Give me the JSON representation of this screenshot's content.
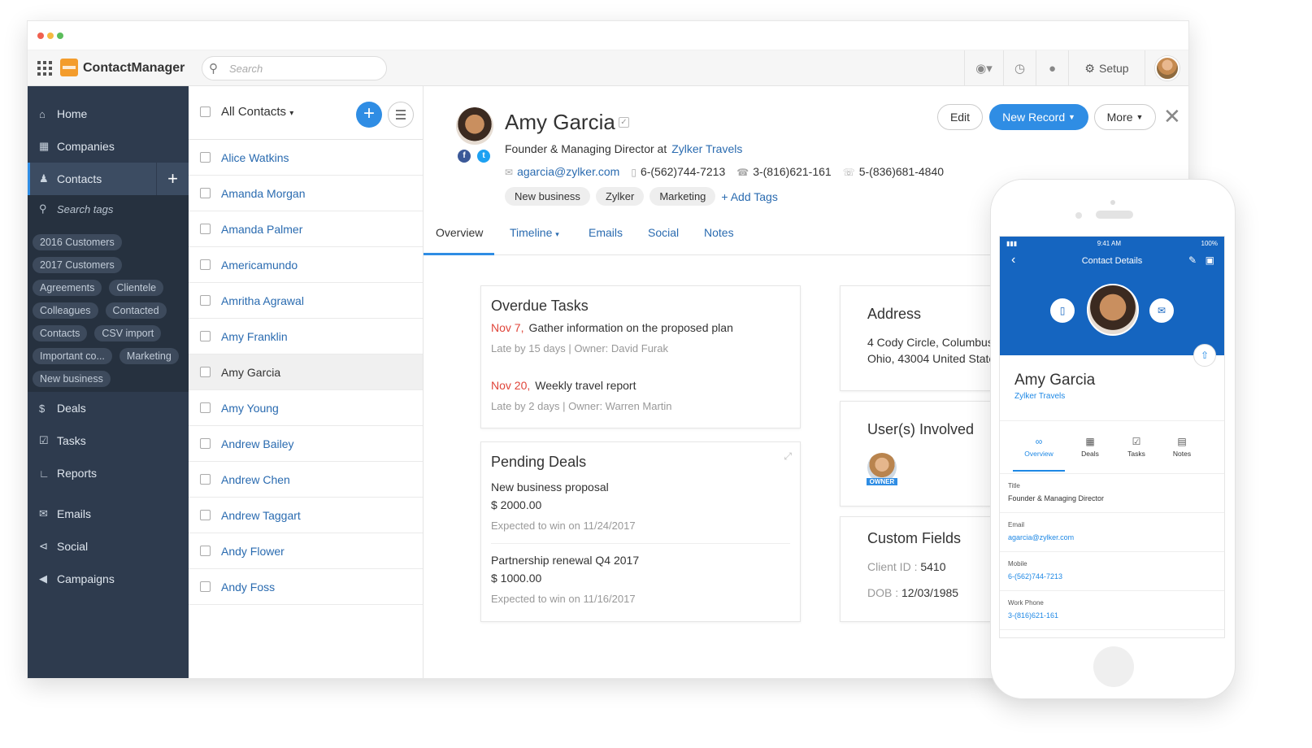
{
  "app": {
    "name": "ContactManager"
  },
  "topbar": {
    "search_placeholder": "Search",
    "icons": [
      "globe-icon",
      "clock-icon",
      "notification-icon",
      "gear-icon"
    ],
    "setup_label": "Setup"
  },
  "sidebar": {
    "nav_top": [
      {
        "label": "Home",
        "icon": "home-icon"
      },
      {
        "label": "Companies",
        "icon": "building-icon"
      },
      {
        "label": "Contacts",
        "icon": "person-icon",
        "active": true
      }
    ],
    "search_tags_placeholder": "Search tags",
    "tags": [
      "2016 Customers",
      "2017 Customers",
      "Agreements",
      "Clientele",
      "Colleagues",
      "Contacted",
      "Contacts",
      "CSV import",
      "Important co...",
      "Marketing",
      "New business"
    ],
    "nav_bottom": [
      {
        "label": "Deals",
        "icon": "dollar-icon"
      },
      {
        "label": "Tasks",
        "icon": "tasks-icon"
      },
      {
        "label": "Reports",
        "icon": "chart-icon"
      },
      {
        "label": "Emails",
        "icon": "mail-icon"
      },
      {
        "label": "Social",
        "icon": "share-icon"
      },
      {
        "label": "Campaigns",
        "icon": "megaphone-icon"
      }
    ]
  },
  "contact_list": {
    "filter_label": "All Contacts",
    "contacts": [
      "Alice Watkins",
      "Amanda Morgan",
      "Amanda Palmer",
      "Americamundo",
      "Amritha Agrawal",
      "Amy Franklin",
      "Amy Garcia",
      "Amy Young",
      "Andrew Bailey",
      "Andrew Chen",
      "Andrew Taggart",
      "Andy Flower",
      "Andy Foss"
    ],
    "selected": "Amy Garcia"
  },
  "contact": {
    "name": "Amy Garcia",
    "title": "Founder & Managing Director at",
    "company": "Zylker Travels",
    "email": "agarcia@zylker.com",
    "mobile": "6-(562)744-7213",
    "phone": "3-(816)621-161",
    "fax": "5-(836)681-4840",
    "tags": [
      "New business",
      "Zylker",
      "Marketing"
    ],
    "add_tags_label": "+ Add Tags"
  },
  "actions": {
    "edit": "Edit",
    "new_record": "New Record",
    "more": "More"
  },
  "tabs": [
    "Overview",
    "Timeline",
    "Emails",
    "Social",
    "Notes"
  ],
  "overdue_tasks": {
    "title": "Overdue Tasks",
    "items": [
      {
        "date": "Nov 7,",
        "text": "Gather information on the proposed plan",
        "meta": "Late by 15 days | Owner: David Furak"
      },
      {
        "date": "Nov 20,",
        "text": "Weekly travel report",
        "meta": "Late by 2 days | Owner: Warren Martin"
      }
    ]
  },
  "pending_deals": {
    "title": "Pending Deals",
    "items": [
      {
        "name": "New business proposal",
        "amount": "$ 2000.00",
        "expected": "Expected to win on 11/24/2017"
      },
      {
        "name": "Partnership renewal Q4 2017",
        "amount": "$ 1000.00",
        "expected": "Expected to win on 11/16/2017"
      }
    ]
  },
  "address": {
    "title": "Address",
    "line1": "4 Cody Circle, Columbus",
    "line2": "Ohio, 43004 United State"
  },
  "users_involved": {
    "title": "User(s) Involved",
    "owner_badge": "OWNER"
  },
  "custom_fields": {
    "title": "Custom Fields",
    "client_id_label": "Client ID :",
    "client_id": "5410",
    "dob_label": "DOB :",
    "dob": "12/03/1985"
  },
  "phone_app": {
    "time": "9:41 AM",
    "battery": "100%",
    "header": "Contact Details",
    "name": "Amy Garcia",
    "company": "Zylker Travels",
    "tabs": [
      "Overview",
      "Deals",
      "Tasks",
      "Notes"
    ],
    "fields": [
      {
        "label": "Title",
        "value": "Founder & Managing Director"
      },
      {
        "label": "Email",
        "value": "agarcia@zylker.com"
      },
      {
        "label": "Mobile",
        "value": "6-(562)744-7213"
      },
      {
        "label": "Work Phone",
        "value": "3-(816)621-161"
      }
    ]
  },
  "colors": {
    "accent": "#2f8de4",
    "sidebar": "#2e3b4e",
    "overdue": "#e0453a",
    "phone_header": "#1565c0"
  }
}
